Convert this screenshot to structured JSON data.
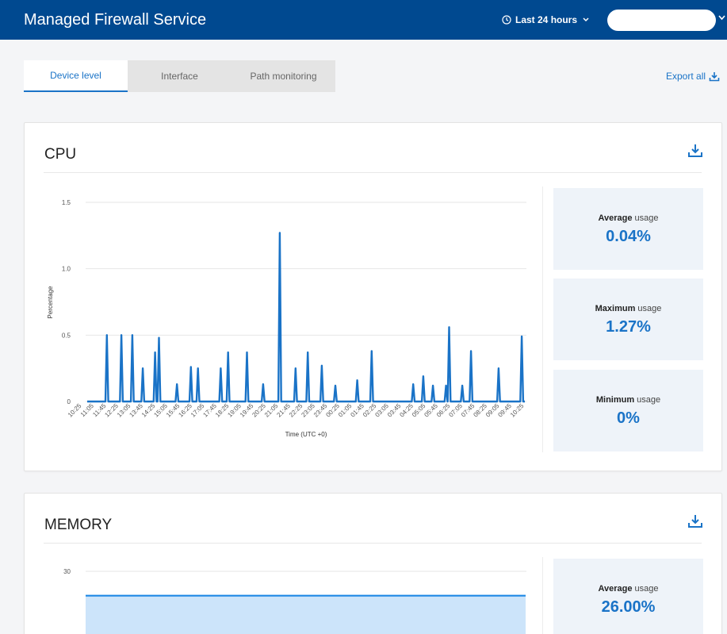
{
  "header": {
    "title": "Managed Firewall Service",
    "time_range": "Last 24 hours",
    "bg_color": "#004990"
  },
  "tabs": [
    {
      "label": "Device level",
      "active": true
    },
    {
      "label": "Interface",
      "active": false
    },
    {
      "label": "Path monitoring",
      "active": false
    }
  ],
  "export_all": "Export all",
  "accent_color": "#1a73c7",
  "cpu": {
    "title": "CPU",
    "stats": [
      {
        "label_bold": "Average",
        "label_rest": " usage",
        "value": "0.04%"
      },
      {
        "label_bold": "Maximum",
        "label_rest": " usage",
        "value": "1.27%"
      },
      {
        "label_bold": "Minimum",
        "label_rest": " usage",
        "value": "0%"
      }
    ]
  },
  "memory": {
    "title": "MEMORY",
    "stats": [
      {
        "label_bold": "Average",
        "label_rest": " usage",
        "value": "26.00%"
      }
    ]
  },
  "chart_data": [
    {
      "type": "line",
      "xlabel": "Time (UTC +0)",
      "ylabel": "Percentage",
      "ylim": [
        0,
        1.5
      ],
      "yticks": [
        "0",
        "0.5",
        "1.0",
        "1.5"
      ],
      "x_ticks": [
        "10:25",
        "11:05",
        "11:45",
        "12:25",
        "13:05",
        "13:45",
        "14:25",
        "15:05",
        "15:45",
        "16:25",
        "17:05",
        "17:45",
        "18:25",
        "19:05",
        "19:45",
        "20:25",
        "21:05",
        "21:45",
        "22:25",
        "23:05",
        "23:45",
        "00:25",
        "01:05",
        "01:45",
        "02:25",
        "03:05",
        "03:45",
        "04:25",
        "05:05",
        "05:45",
        "06:25",
        "07:05",
        "07:45",
        "08:25",
        "09:05",
        "09:45",
        "10:25"
      ],
      "spikes": [
        {
          "t": 0.045,
          "v": 0.5
        },
        {
          "t": 0.078,
          "v": 0.5
        },
        {
          "t": 0.103,
          "v": 0.5
        },
        {
          "t": 0.127,
          "v": 0.25
        },
        {
          "t": 0.155,
          "v": 0.37
        },
        {
          "t": 0.164,
          "v": 0.48
        },
        {
          "t": 0.205,
          "v": 0.13
        },
        {
          "t": 0.237,
          "v": 0.26
        },
        {
          "t": 0.253,
          "v": 0.25
        },
        {
          "t": 0.305,
          "v": 0.25
        },
        {
          "t": 0.322,
          "v": 0.37
        },
        {
          "t": 0.365,
          "v": 0.37
        },
        {
          "t": 0.402,
          "v": 0.13
        },
        {
          "t": 0.44,
          "v": 1.27
        },
        {
          "t": 0.476,
          "v": 0.25
        },
        {
          "t": 0.504,
          "v": 0.37
        },
        {
          "t": 0.536,
          "v": 0.27
        },
        {
          "t": 0.567,
          "v": 0.12
        },
        {
          "t": 0.617,
          "v": 0.16
        },
        {
          "t": 0.65,
          "v": 0.38
        },
        {
          "t": 0.745,
          "v": 0.13
        },
        {
          "t": 0.768,
          "v": 0.19
        },
        {
          "t": 0.79,
          "v": 0.12
        },
        {
          "t": 0.82,
          "v": 0.12
        },
        {
          "t": 0.827,
          "v": 0.56
        },
        {
          "t": 0.857,
          "v": 0.12
        },
        {
          "t": 0.877,
          "v": 0.38
        },
        {
          "t": 0.94,
          "v": 0.25
        },
        {
          "t": 0.993,
          "v": 0.49
        }
      ]
    },
    {
      "type": "area",
      "ylim": [
        0,
        30
      ],
      "yticks": [
        "30"
      ],
      "values": [
        26,
        26
      ],
      "fill_color": "#cce4fa",
      "line_color": "#1e88e5"
    }
  ]
}
